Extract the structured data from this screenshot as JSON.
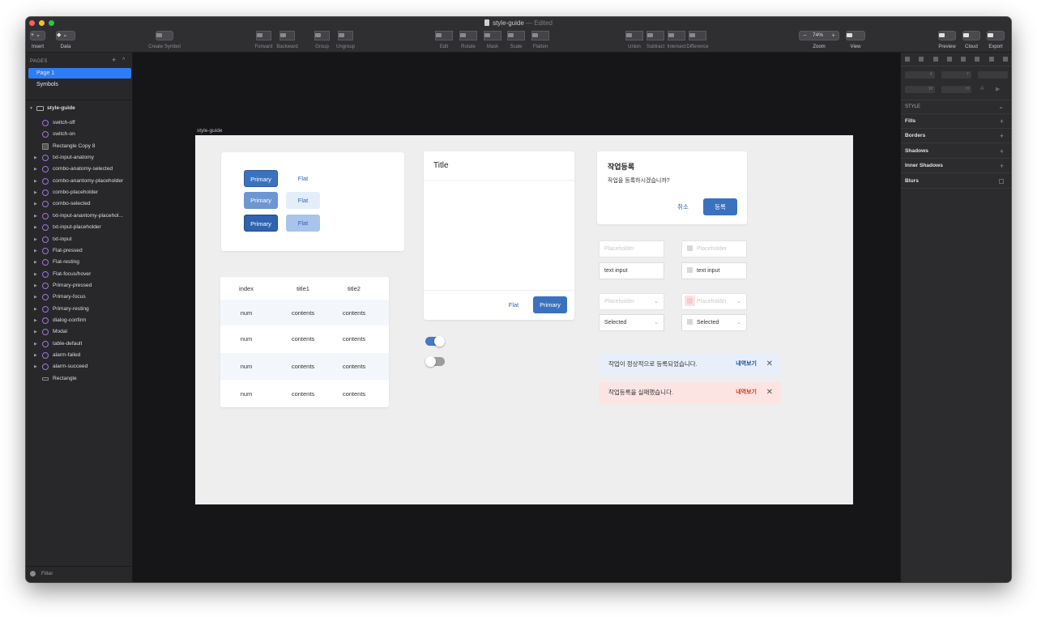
{
  "window": {
    "doc_name": "style-guide",
    "doc_status": " — Edited"
  },
  "toolbar": [
    {
      "name": "insert",
      "label": "Insert",
      "glyph": "+ ⌄"
    },
    {
      "name": "data",
      "label": "Data",
      "glyph": "◆ ⌄"
    },
    {
      "name": "create-symbol",
      "label": "Create Symbol"
    },
    {
      "name": "forward",
      "label": "Forward"
    },
    {
      "name": "backward",
      "label": "Backward"
    },
    {
      "name": "group",
      "label": "Group"
    },
    {
      "name": "ungroup",
      "label": "Ungroup"
    },
    {
      "name": "edit",
      "label": "Edit"
    },
    {
      "name": "rotate",
      "label": "Rotate"
    },
    {
      "name": "mask",
      "label": "Mask"
    },
    {
      "name": "scale",
      "label": "Scale"
    },
    {
      "name": "flatten",
      "label": "Flatten"
    },
    {
      "name": "union",
      "label": "Union"
    },
    {
      "name": "subtract",
      "label": "Subtract"
    },
    {
      "name": "intersect",
      "label": "Intersect"
    },
    {
      "name": "difference",
      "label": "Difference"
    },
    {
      "name": "zoom",
      "label": "Zoom",
      "value": "74%",
      "minus": "−",
      "plus": "+"
    },
    {
      "name": "view",
      "label": "View"
    },
    {
      "name": "preview",
      "label": "Preview"
    },
    {
      "name": "cloud",
      "label": "Cloud"
    },
    {
      "name": "export",
      "label": "Export"
    }
  ],
  "pages": {
    "title": "PAGES",
    "add": "+",
    "collapse": "^",
    "items": [
      "Page 1",
      "Symbols"
    ]
  },
  "layers": {
    "artboard": "style-guide",
    "items": [
      "switch-off",
      "switch-on",
      "Rectangle Copy 8",
      "txt-input-anatomy",
      "combo-anatomy-selected",
      "combo-anantomy-placeholder",
      "combo-placeholder",
      "combo-selected",
      "txt-input-anantomy-placehol...",
      "txt-input-placeholder",
      "txt-input",
      "Flat-pressed",
      "Flat-resting",
      "Flat-focus/hover",
      "Primary-pressed",
      "Primary-focus",
      "Primary-resting",
      "dialog-confirm",
      "Modal",
      "table-default",
      "alarm-failed",
      "alarm-succeed",
      "Rectangle"
    ]
  },
  "filter": "Filter",
  "inspector": {
    "fields": {
      "x": "X",
      "y": "Y",
      "w": "W",
      "h": "H"
    },
    "style": "STYLE",
    "rows": [
      "Fills",
      "Borders",
      "Shadows",
      "Inner Shadows",
      "Blurs"
    ]
  },
  "artboard_label": "style-guide",
  "buttons": {
    "primary": "Primary",
    "flat": "Flat"
  },
  "table": {
    "headers": [
      "index",
      "title1",
      "title2"
    ],
    "rows": [
      [
        "num",
        "contents",
        "contents"
      ],
      [
        "num",
        "contents",
        "contents"
      ],
      [
        "num",
        "contents",
        "contents"
      ],
      [
        "num",
        "contents",
        "contents"
      ]
    ]
  },
  "modal": {
    "title": "Title",
    "flat": "Flat",
    "primary": "Primary"
  },
  "dialog": {
    "title": "작업등록",
    "message": "작업을 등록하시겠습니까?",
    "cancel": "취소",
    "confirm": "등록"
  },
  "inputs": {
    "placeholder": "Placeholder",
    "text": "text input",
    "selected": "Selected"
  },
  "toasts": [
    {
      "message": "작업이 정상적으로 등록되었습니다.",
      "action": "내역보기",
      "close": "✕",
      "bg": "#e8effa",
      "accent": "#1f4f9a"
    },
    {
      "message": "작업등록을 실패했습니다.",
      "action": "내역보기",
      "close": "✕",
      "bg": "#fce4e2",
      "accent": "#d33a2c"
    }
  ],
  "colors": {
    "accent": "#3b72c0",
    "selection": "#2e7cf6"
  }
}
